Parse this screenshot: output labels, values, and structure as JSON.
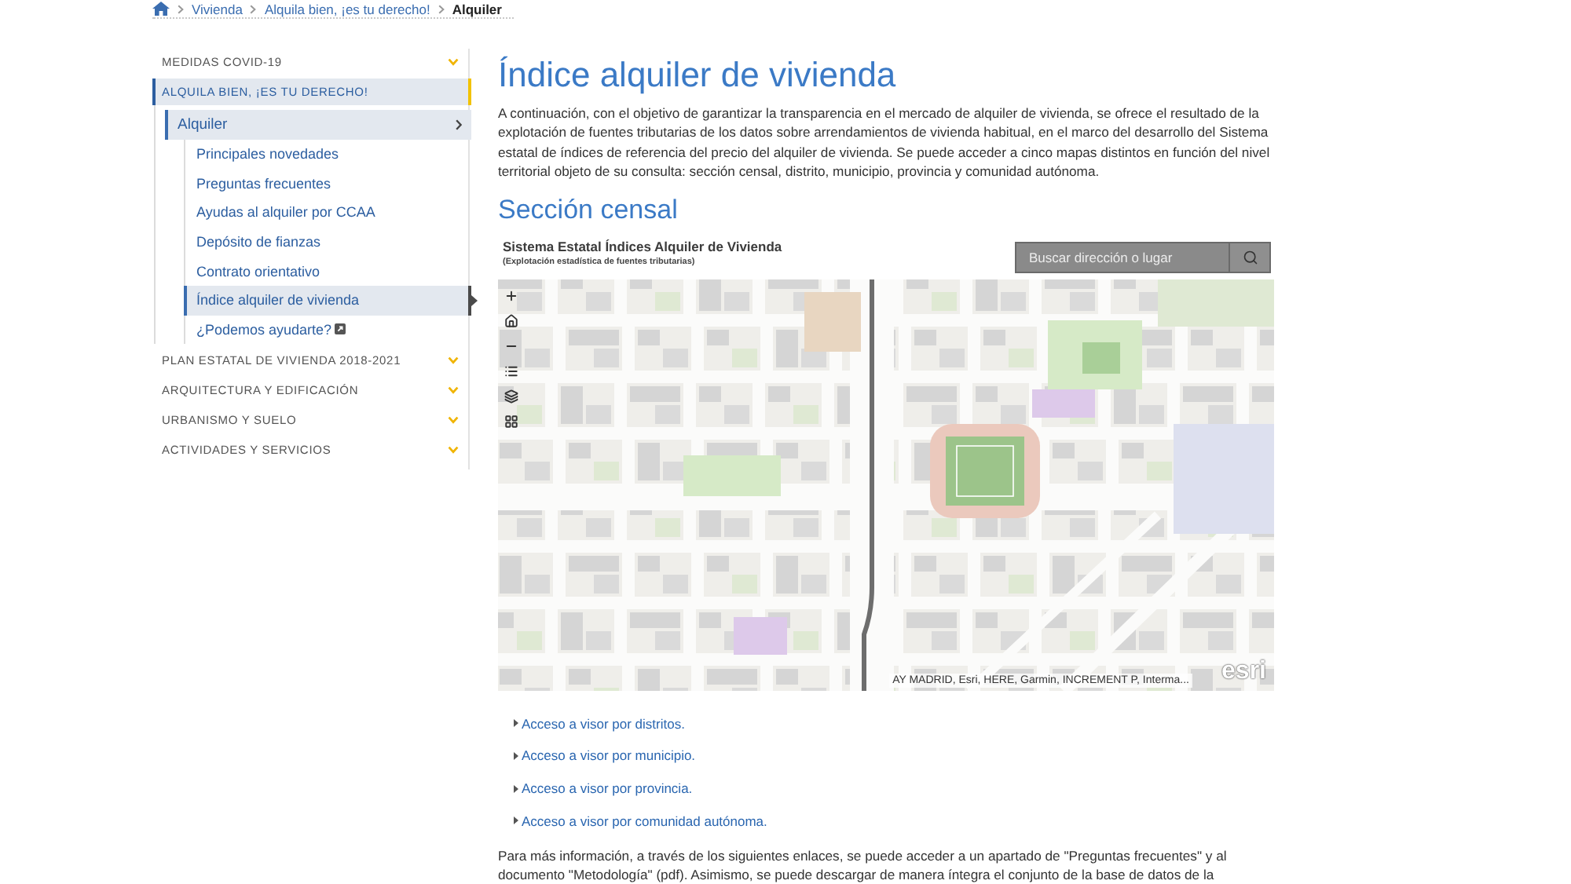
{
  "breadcrumb": {
    "items": [
      {
        "label": "Vivienda",
        "current": false
      },
      {
        "label": "Alquila bien, ¡es tu derecho!",
        "current": false
      },
      {
        "label": "Alquiler",
        "current": true
      }
    ]
  },
  "sidebar": {
    "sections": [
      {
        "label": "MEDIDAS COVID-19",
        "selected": false,
        "expanded": false
      },
      {
        "label": "ALQUILA BIEN, ¡ES TU DERECHO!",
        "selected": true,
        "expanded": true,
        "children": [
          {
            "label": "Alquiler",
            "selected": true,
            "expanded": true,
            "children": [
              {
                "label": "Principales novedades",
                "selected": false,
                "external": false
              },
              {
                "label": "Preguntas frecuentes",
                "selected": false,
                "external": false
              },
              {
                "label": "Ayudas al alquiler por CCAA",
                "selected": false,
                "external": false
              },
              {
                "label": "Depósito de fianzas",
                "selected": false,
                "external": false
              },
              {
                "label": "Contrato orientativo",
                "selected": false,
                "external": false
              },
              {
                "label": "Índice alquiler de vivienda",
                "selected": true,
                "external": false
              },
              {
                "label": "¿Podemos ayudarte?",
                "selected": false,
                "external": true
              }
            ]
          }
        ]
      },
      {
        "label": "PLAN ESTATAL DE VIVIENDA 2018-2021",
        "selected": false,
        "expanded": false
      },
      {
        "label": "ARQUITECTURA Y EDIFICACIÓN",
        "selected": false,
        "expanded": false
      },
      {
        "label": "URBANISMO Y SUELO",
        "selected": false,
        "expanded": false
      },
      {
        "label": "ACTIVIDADES Y SERVICIOS",
        "selected": false,
        "expanded": false
      }
    ]
  },
  "main": {
    "title": "Índice alquiler de vivienda",
    "intro": "A continuación, con el objetivo de garantizar la transparencia en el mercado de alquiler de vivienda, se ofrece el resultado de la explotación de fuentes tributarias de los datos sobre arrendamientos de vivienda habitual, en el marco del desarrollo del Sistema estatal de índices de referencia del precio del alquiler de vivienda. Se puede acceder a cinco mapas distintos en función del nivel territorial objeto de su consulta: sección censal, distrito, municipio, provincia y comunidad autónoma.",
    "section_title": "Sección censal",
    "map": {
      "title": "Sistema Estatal Índices Alquiler de Vivienda",
      "subtitle": "(Explotación estadística de fuentes tributarias)",
      "search": {
        "placeholder": "Buscar dirección o lugar"
      },
      "attribution": "AY MADRID, Esri, HERE, Garmin, INCREMENT P, Interma...",
      "logo": "esri"
    },
    "links": [
      "Acceso a visor por distritos.",
      "Acceso a visor por municipio.",
      "Acceso a visor por provincia.",
      "Acceso a visor por comunidad autónoma."
    ],
    "more_info": "Para más información, a través de los siguientes enlaces, se puede acceder a un apartado de \"Preguntas frecuentes\" y al documento \"Metodología\" (pdf). Asimismo, se puede descargar de manera íntegra el conjunto de la base de datos de la"
  }
}
